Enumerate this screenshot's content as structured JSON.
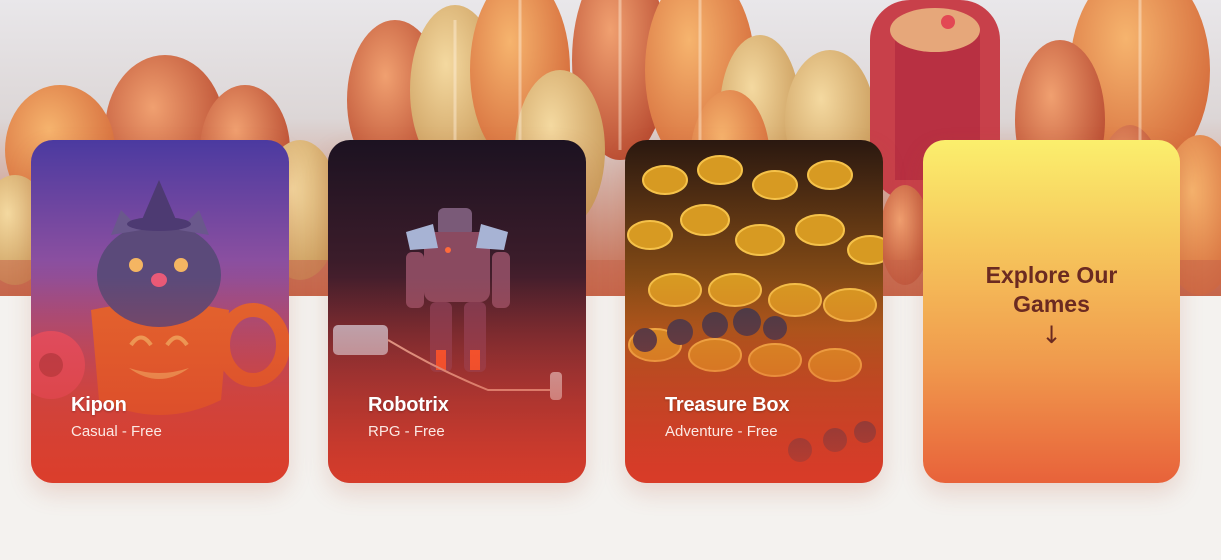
{
  "games": [
    {
      "title": "Kipon",
      "subtitle": "Casual - Free"
    },
    {
      "title": "Robotrix",
      "subtitle": "RPG - Free"
    },
    {
      "title": "Treasure Box",
      "subtitle": "Adventure - Free"
    }
  ],
  "explore": {
    "label": "Explore Our Games",
    "arrow": "↓"
  },
  "colors": {
    "page_background": "#f4f2ef",
    "explore_text": "#6b2a21",
    "explore_gradient_top": "#fbef6d",
    "explore_gradient_bottom": "#e8623a"
  },
  "icons": [
    "arrow-down-icon"
  ]
}
